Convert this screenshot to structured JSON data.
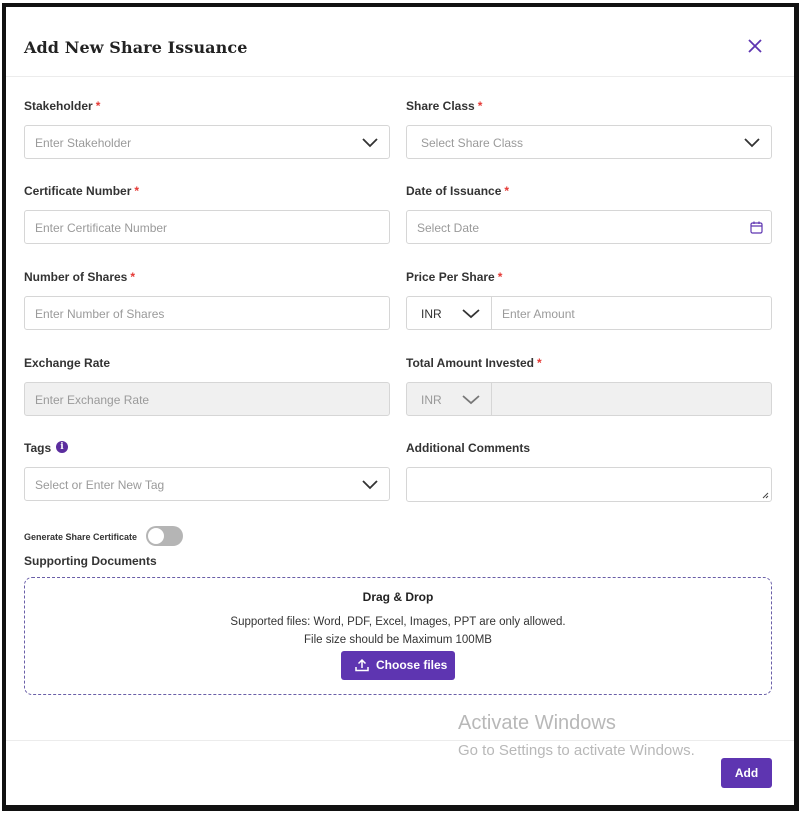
{
  "dialog": {
    "title": "Add New Share Issuance"
  },
  "form": {
    "stakeholder": {
      "label": "Stakeholder",
      "required": "*",
      "placeholder": "Enter Stakeholder"
    },
    "share_class": {
      "label": "Share Class",
      "required": "*",
      "placeholder": "Select Share Class"
    },
    "certificate_number": {
      "label": "Certificate Number",
      "required": "*",
      "placeholder": "Enter Certificate Number"
    },
    "date_of_issuance": {
      "label": "Date of Issuance",
      "required": "*",
      "placeholder": "Select Date"
    },
    "number_of_shares": {
      "label": "Number of Shares",
      "required": "*",
      "placeholder": "Enter Number of Shares"
    },
    "price_per_share": {
      "label": "Price Per Share",
      "required": "*",
      "currency": "INR",
      "placeholder": "Enter Amount"
    },
    "exchange_rate": {
      "label": "Exchange Rate",
      "placeholder": "Enter Exchange Rate"
    },
    "total_amount_invested": {
      "label": "Total Amount Invested",
      "required": "*",
      "currency": "INR"
    },
    "tags": {
      "label": "Tags",
      "info": "i",
      "placeholder": "Select or Enter New Tag"
    },
    "additional_comments": {
      "label": "Additional Comments"
    },
    "generate_certificate": {
      "label": "Generate Share Certificate",
      "enabled": false
    }
  },
  "documents": {
    "label": "Supporting Documents",
    "drop_title": "Drag & Drop",
    "supported": "Supported files: Word, PDF, Excel, Images, PPT are only allowed.",
    "max_size": "File size should be Maximum 100MB",
    "choose_button": "Choose files"
  },
  "watermark": {
    "line1": "Activate Windows",
    "line2": "Go to Settings to activate Windows."
  },
  "footer": {
    "add_button": "Add"
  },
  "colors": {
    "accent": "#5e35b1",
    "required": "#e53935",
    "border": "#d6d6d6",
    "disabled_bg": "#f0f0f0"
  },
  "icons": {
    "close": "close-icon",
    "chevron": "chevron-down-icon",
    "calendar": "calendar-icon",
    "info": "info-icon",
    "upload": "upload-icon"
  }
}
